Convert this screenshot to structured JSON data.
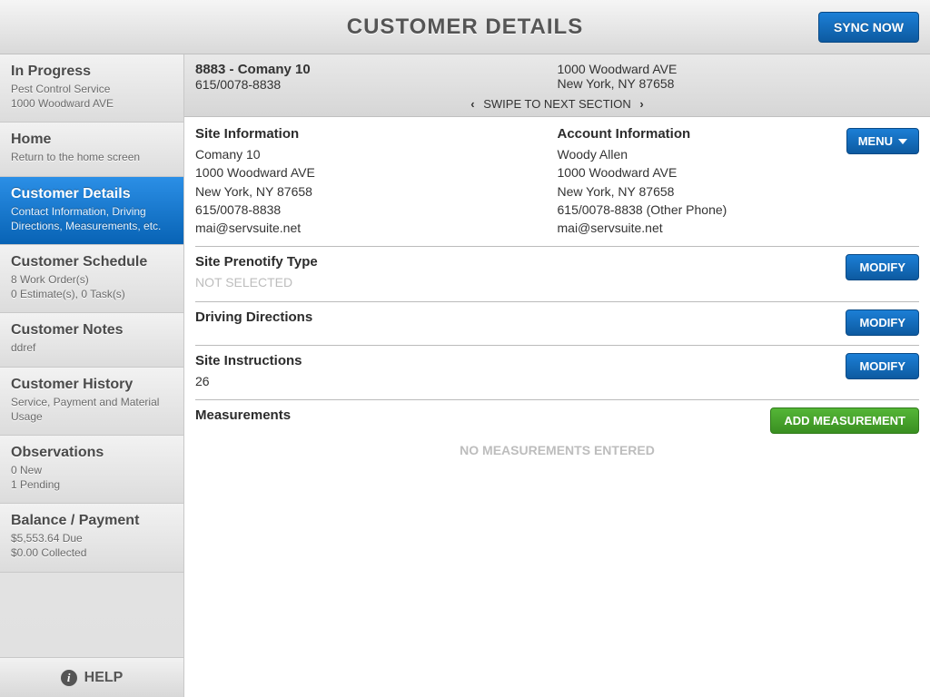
{
  "header": {
    "title": "CUSTOMER DETAILS",
    "sync_label": "SYNC NOW"
  },
  "sidebar": {
    "items": [
      {
        "title": "In Progress",
        "sub1": "Pest Control Service",
        "sub2": "1000 Woodward AVE"
      },
      {
        "title": "Home",
        "sub1": "Return to the home screen",
        "sub2": ""
      },
      {
        "title": "Customer Details",
        "sub1": "Contact Information, Driving",
        "sub2": "Directions, Measurements, etc."
      },
      {
        "title": "Customer Schedule",
        "sub1": "8 Work Order(s)",
        "sub2": "0 Estimate(s), 0 Task(s)"
      },
      {
        "title": "Customer Notes",
        "sub1": "ddref",
        "sub2": ""
      },
      {
        "title": "Customer History",
        "sub1": "Service, Payment and Material",
        "sub2": "Usage"
      },
      {
        "title": "Observations",
        "sub1": "0 New",
        "sub2": "1 Pending"
      },
      {
        "title": "Balance / Payment",
        "sub1": "$5,553.64 Due",
        "sub2": "$0.00 Collected"
      }
    ],
    "help_label": "HELP"
  },
  "infobar": {
    "name": "8883 - Comany 10",
    "phone": "615/0078-8838",
    "addr1": "1000 Woodward AVE",
    "addr2": "New York, NY 87658",
    "swipe_label": "SWIPE TO NEXT SECTION"
  },
  "site": {
    "heading": "Site Information",
    "company": "Comany 10",
    "addr1": "1000 Woodward AVE",
    "addr2": "New York, NY 87658",
    "phone": "615/0078-8838",
    "email": "mai@servsuite.net"
  },
  "account": {
    "heading": "Account Information",
    "name": "Woody Allen",
    "addr1": "1000 Woodward AVE",
    "addr2": "New York, NY 87658",
    "phone": "615/0078-8838 (Other Phone)",
    "email": "mai@servsuite.net",
    "menu_label": "MENU"
  },
  "prenotify": {
    "heading": "Site Prenotify Type",
    "value": "NOT SELECTED",
    "modify_label": "MODIFY"
  },
  "driving": {
    "heading": "Driving Directions",
    "modify_label": "MODIFY"
  },
  "instructions": {
    "heading": "Site Instructions",
    "value": "26",
    "modify_label": "MODIFY"
  },
  "measurements": {
    "heading": "Measurements",
    "add_label": "ADD MEASUREMENT",
    "empty": "NO MEASUREMENTS ENTERED"
  }
}
